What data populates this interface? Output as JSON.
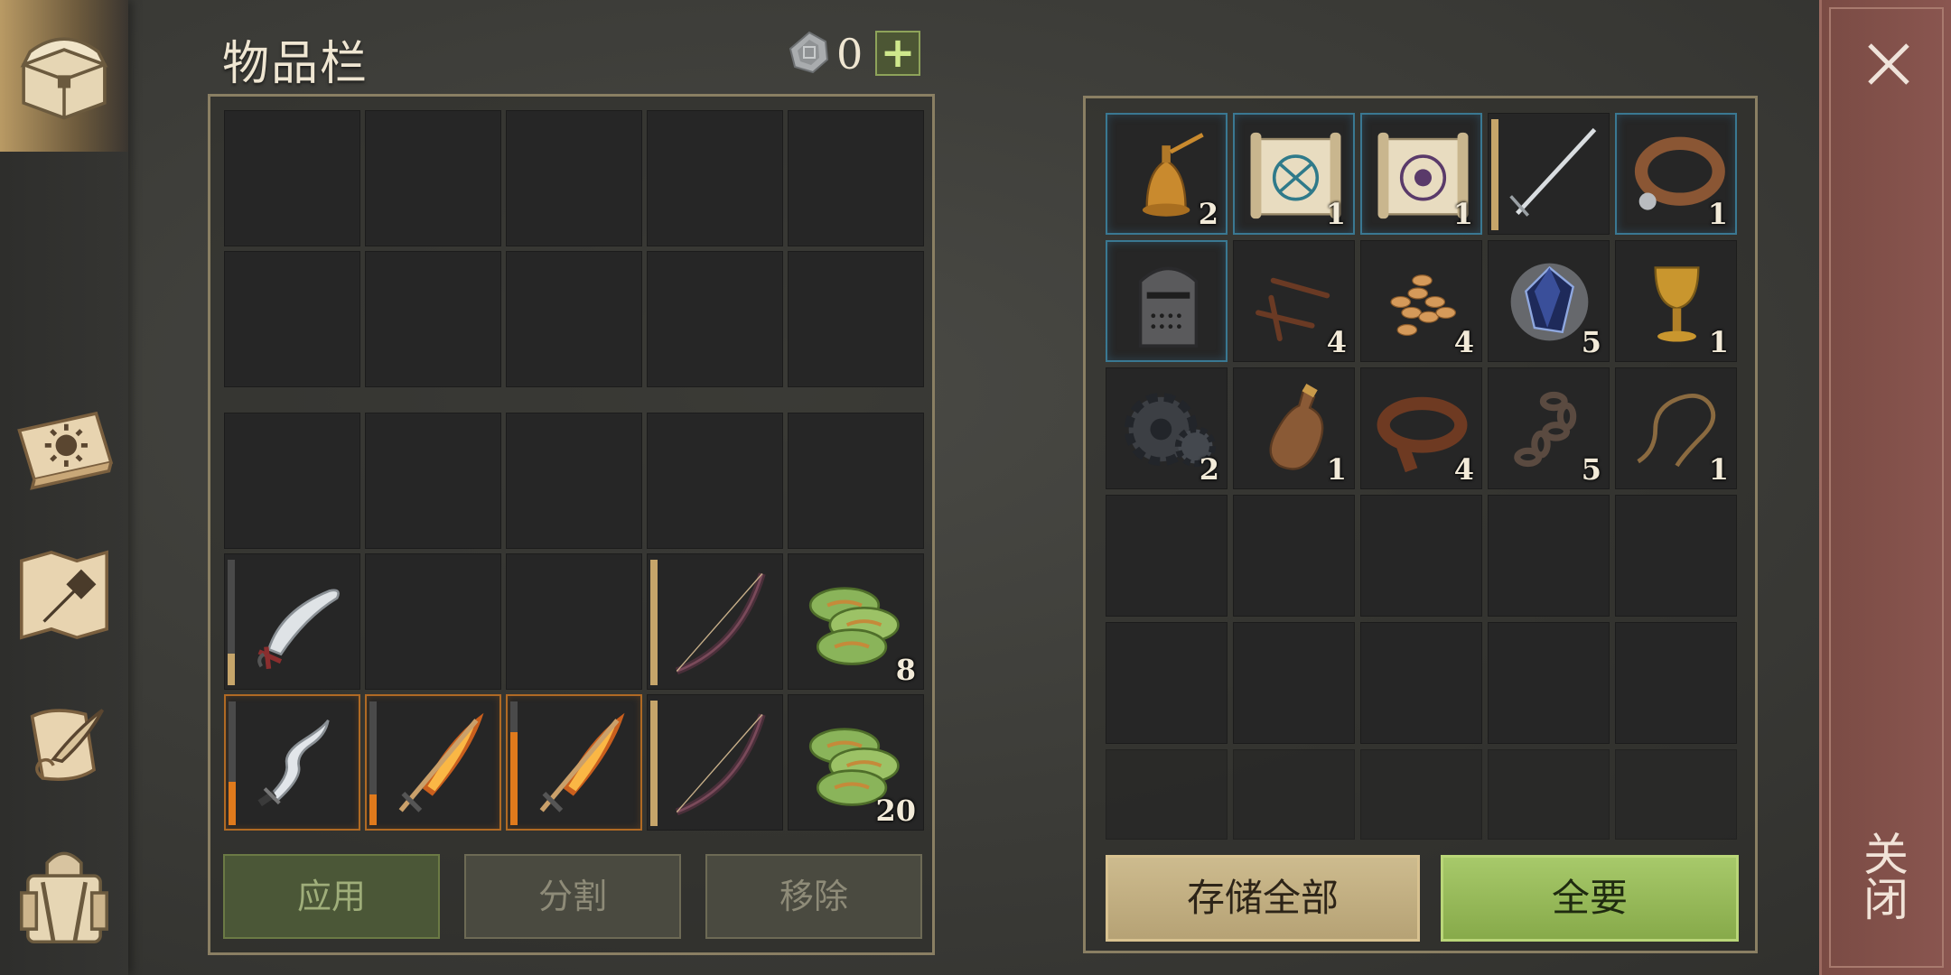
{
  "window": {
    "title": "物品栏",
    "close_label": "关闭"
  },
  "currency": {
    "icon": "silver-coin-icon",
    "value": "0",
    "add_label": "+"
  },
  "sidebar": [
    {
      "icon": "chest-icon",
      "active": true
    },
    {
      "icon": "sun-book-icon",
      "active": false
    },
    {
      "icon": "hammer-map-icon",
      "active": false
    },
    {
      "icon": "quill-scroll-icon",
      "active": false
    },
    {
      "icon": "backpack-icon",
      "active": false
    }
  ],
  "inventory": {
    "row4": [
      {
        "icon": "scimitar-icon",
        "count": "",
        "durability": 0.25,
        "bar_color": "#c6a56a"
      },
      {
        "icon": "",
        "count": ""
      },
      {
        "icon": "",
        "count": ""
      },
      {
        "icon": "bow-icon",
        "count": "",
        "durability": 1.0,
        "bar_color": "#c6a56a"
      },
      {
        "icon": "plant-fiber-icon",
        "count": "8"
      }
    ],
    "row5": [
      {
        "icon": "wavy-dagger-icon",
        "count": "",
        "durability": 0.35,
        "bar_color": "#e07a1c"
      },
      {
        "icon": "flaming-sword-icon",
        "count": "",
        "durability": 0.25,
        "bar_color": "#e07a1c"
      },
      {
        "icon": "flaming-sword-icon",
        "count": "",
        "durability": 0.75,
        "bar_color": "#e07a1c"
      },
      {
        "icon": "bow-icon",
        "count": "",
        "durability": 1.0,
        "bar_color": "#c6a56a"
      },
      {
        "icon": "plant-fiber-icon",
        "count": "20"
      }
    ]
  },
  "inventory_buttons": {
    "apply": "应用",
    "split": "分割",
    "remove": "移除"
  },
  "storage": {
    "row1": [
      {
        "icon": "bell-icon",
        "count": "2"
      },
      {
        "icon": "blue-rune-scroll-icon",
        "count": "1"
      },
      {
        "icon": "purple-rune-scroll-icon",
        "count": "1"
      },
      {
        "icon": "longsword-icon",
        "count": ""
      },
      {
        "icon": "leather-collar-icon",
        "count": "1"
      }
    ],
    "row2": [
      {
        "icon": "great-helm-icon",
        "count": ""
      },
      {
        "icon": "nails-icon",
        "count": "4"
      },
      {
        "icon": "seeds-icon",
        "count": "4"
      },
      {
        "icon": "crystal-icon",
        "count": "5"
      },
      {
        "icon": "goblet-icon",
        "count": "1"
      }
    ],
    "row3": [
      {
        "icon": "gear-icon",
        "count": "2"
      },
      {
        "icon": "bottle-icon",
        "count": "1"
      },
      {
        "icon": "leather-strip-icon",
        "count": "4"
      },
      {
        "icon": "chain-icon",
        "count": "5"
      },
      {
        "icon": "rope-icon",
        "count": "1"
      }
    ]
  },
  "storage_buttons": {
    "store_all": "存储全部",
    "take_all": "全要"
  }
}
